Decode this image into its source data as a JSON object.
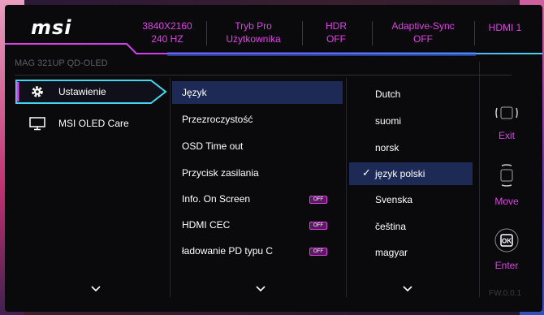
{
  "header": {
    "logo": "msi",
    "resolution": "3840X2160",
    "refresh": "240 HZ",
    "mode_line1": "Tryb Pro",
    "mode_line2": "Użytkownika",
    "hdr_label": "HDR",
    "hdr_value": "OFF",
    "adaptive_label": "Adaptive-Sync",
    "adaptive_value": "OFF",
    "input": "HDMI 1"
  },
  "model": "MAG 321UP QD-OLED",
  "main_menu": [
    {
      "label": "Ustawienie",
      "icon": "gear-icon",
      "selected": true
    },
    {
      "label": "MSI OLED Care",
      "icon": "monitor-icon",
      "selected": false
    }
  ],
  "submenu": [
    {
      "label": "Język",
      "active": true,
      "badge": ""
    },
    {
      "label": "Przezroczystość",
      "active": false,
      "badge": ""
    },
    {
      "label": "OSD Time out",
      "active": false,
      "badge": ""
    },
    {
      "label": "Przycisk zasilania",
      "active": false,
      "badge": ""
    },
    {
      "label": "Info. On Screen",
      "active": false,
      "badge": "OFF"
    },
    {
      "label": "HDMI CEC",
      "active": false,
      "badge": "OFF"
    },
    {
      "label": "ładowanie PD typu C",
      "active": false,
      "badge": "OFF"
    }
  ],
  "languages": [
    {
      "label": "Dutch",
      "selected": false
    },
    {
      "label": "suomi",
      "selected": false
    },
    {
      "label": "norsk",
      "selected": false
    },
    {
      "label": "język polski",
      "selected": true
    },
    {
      "label": "Svenska",
      "selected": false
    },
    {
      "label": "čeština",
      "selected": false
    },
    {
      "label": "magyar",
      "selected": false
    }
  ],
  "nav": {
    "exit_label": "Exit",
    "move_label": "Move",
    "enter_label": "Enter",
    "ok_text": "OK"
  },
  "firmware": "FW.0.0.1",
  "colors": {
    "accent": "#e040e8",
    "highlight": "#1e2a56",
    "cyan": "#3fd8f0"
  }
}
